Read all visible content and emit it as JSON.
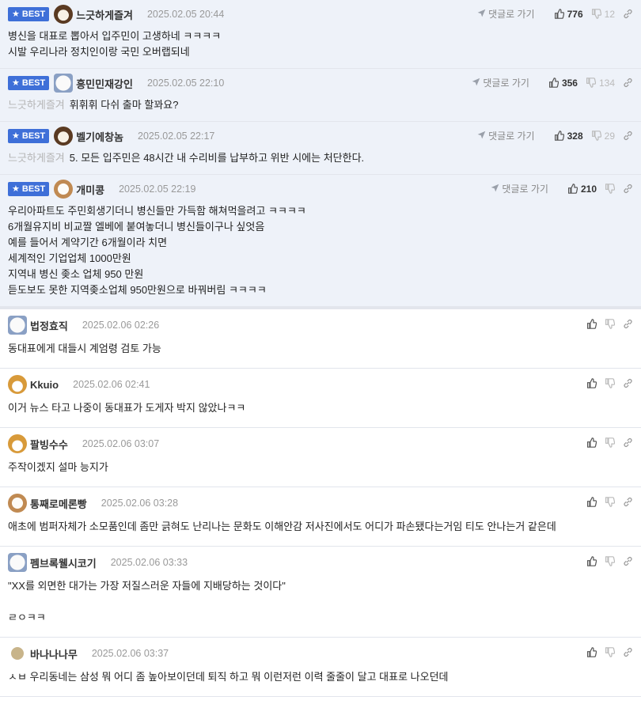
{
  "reply_label": "댓글로 가기",
  "best_label": "BEST",
  "colors": {
    "best_bg": "#eef2f9",
    "badge": "#3e6fd8"
  },
  "comments": [
    {
      "best": true,
      "avatar": "dog-black-white",
      "nick": "느긋하게즐겨",
      "date": "2025.02.05 20:44",
      "up": "776",
      "down": "12",
      "mention": "",
      "lines": [
        "병신을 대표로 뽑아서 입주민이 고생하네 ㅋㅋㅋㅋ",
        "시발 우리나라 정치인이랑 국민 오버랩되네"
      ]
    },
    {
      "best": true,
      "avatar": "white-puppy",
      "nick": "흥민민재강인",
      "date": "2025.02.05 22:10",
      "up": "356",
      "down": "134",
      "mention": "느긋하게즐겨",
      "lines": [
        "휘휘휘 다쉬 출마 할꽈요?"
      ]
    },
    {
      "best": true,
      "avatar": "dog-black-white",
      "nick": "벨기에창놈",
      "date": "2025.02.05 22:17",
      "up": "328",
      "down": "29",
      "mention": "느긋하게즐겨",
      "lines": [
        "5. 모든 입주민은 48시간 내 수리비를 납부하고 위반 시에는 처단한다."
      ]
    },
    {
      "best": true,
      "avatar": "bear",
      "nick": "개미콩",
      "date": "2025.02.05 22:19",
      "up": "210",
      "down": "",
      "mention": "",
      "lines": [
        "우리아파트도 주민회생기더니 병신들만 가득함 해쳐먹을려고 ㅋㅋㅋㅋ",
        "6개월유지비 비교짤 엘베에 붙여놓더니 병신들이구나 싶엇음",
        "예를 들어서 계약기간 6개월이라 치면",
        "세계적인 기업업체 1000만원",
        "지역내 병신 좆소 업체 950 만원",
        "듣도보도 못한 지역좆소업체 950만원으로 바꿔버림 ㅋㅋㅋㅋ"
      ]
    },
    {
      "best": false,
      "avatar": "white-puppy",
      "nick": "법정효직",
      "date": "2025.02.06 02:26",
      "up": "",
      "down": "",
      "mention": "",
      "lines": [
        "동대표에게 대들시 계엄령 검토 가능"
      ]
    },
    {
      "best": false,
      "avatar": "fox",
      "nick": "Kkuio",
      "date": "2025.02.06 02:41",
      "up": "",
      "down": "",
      "mention": "",
      "lines": [
        "이거 뉴스 타고 나중이 동대표가 도게자 박지 않았나ㅋㅋ"
      ]
    },
    {
      "best": false,
      "avatar": "fox",
      "nick": "팔빙수수",
      "date": "2025.02.06 03:07",
      "up": "",
      "down": "",
      "mention": "",
      "lines": [
        "주작이겠지 설마 능지가"
      ]
    },
    {
      "best": false,
      "avatar": "bear",
      "nick": "통째로메론빵",
      "date": "2025.02.06 03:28",
      "up": "",
      "down": "",
      "mention": "",
      "lines": [
        "애초에 범퍼자체가 소모품인데 좀만 긁혀도 난리나는 문화도 이해안감 저사진에서도 어디가 파손됐다는거임 티도 안나는거 같은데"
      ]
    },
    {
      "best": false,
      "avatar": "white-puppy",
      "nick": "펨브록웰시코기",
      "date": "2025.02.06 03:33",
      "up": "",
      "down": "",
      "mention": "",
      "lines": [
        "\"XX를 외면한 대가는 가장 저질스러운 자들에 지배당하는 것이다\"",
        "",
        "ㄹㅇㅋㅋ"
      ]
    },
    {
      "best": false,
      "avatar": "dot",
      "nick": "바나나나무",
      "date": "2025.02.06 03:37",
      "up": "",
      "down": "",
      "mention": "",
      "lines": [
        "ㅅㅂ 우리동네는 삼성 뭐 어디 좀 높아보이던데 퇴직 하고 뭐 이런저런 이력 줄줄이 달고 대표로 나오던데"
      ]
    }
  ]
}
